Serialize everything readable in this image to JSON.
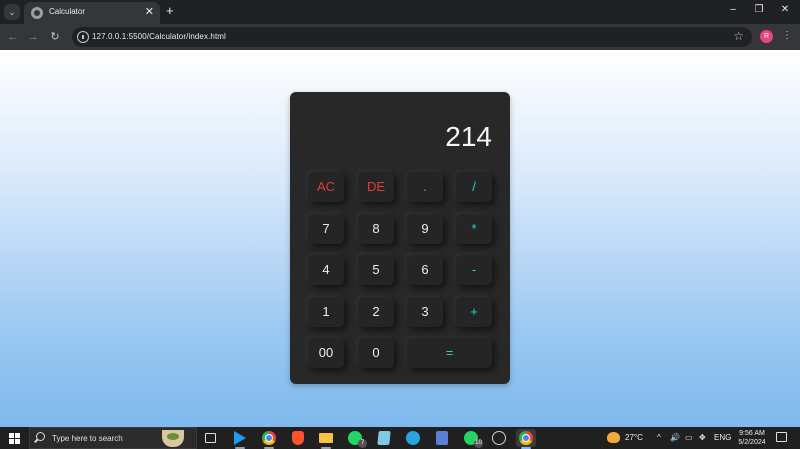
{
  "browser": {
    "tab_title": "Calculator",
    "tab_close": "✕",
    "new_tab": "+",
    "url": "127.0.0.1:5500/Calculator/index.html",
    "profile_initial": "R",
    "window_controls": {
      "minimize": "–",
      "restore": "❐",
      "close": "✕"
    }
  },
  "calculator": {
    "display": "214",
    "colors": {
      "body": "#282828",
      "key": "#252525",
      "red": "#e23b3b",
      "cyan": "#1fd6cf",
      "number": "#eeeeee"
    },
    "keys": {
      "ac": "AC",
      "de": "DE",
      "dot": ".",
      "divide": "/",
      "seven": "7",
      "eight": "8",
      "nine": "9",
      "multiply": "*",
      "four": "4",
      "five": "5",
      "six": "6",
      "minus": "-",
      "one": "1",
      "two": "2",
      "three": "3",
      "plus": "+",
      "double_zero": "00",
      "zero": "0",
      "equals": "="
    }
  },
  "taskbar": {
    "search_placeholder": "Type here to search",
    "weather": "27°C",
    "language": "ENG",
    "time": "9:56 AM",
    "date": "5/2/2024",
    "whatsapp_badge": "7",
    "whatsapp2_badge": "10"
  }
}
